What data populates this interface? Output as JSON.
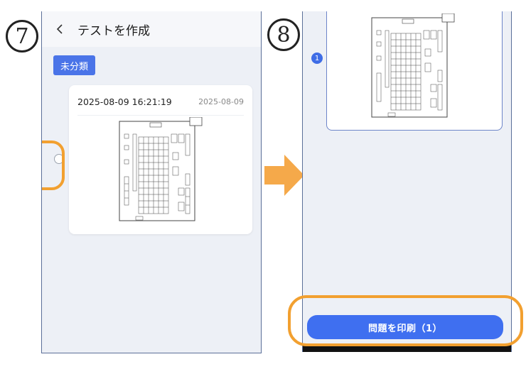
{
  "annotations": {
    "step7": "7",
    "step8": "8",
    "highlight_color": "#f2a030"
  },
  "left_screen": {
    "header": {
      "back_icon": "chevron-left-icon",
      "title": "テストを作成"
    },
    "category_chip": "未分類",
    "test_card": {
      "title": "2025-08-09 16:21:19",
      "date": "2025-08-09",
      "thumbnail": "answer-sheet-thumbnail",
      "selected": false
    }
  },
  "right_screen": {
    "selected_count": "1",
    "print_button": "問題を印刷（1）",
    "thumbnail": "answer-sheet-thumbnail"
  },
  "colors": {
    "accent": "#4a74e8",
    "background": "#edf0f6",
    "arrow": "#f5a94a"
  }
}
